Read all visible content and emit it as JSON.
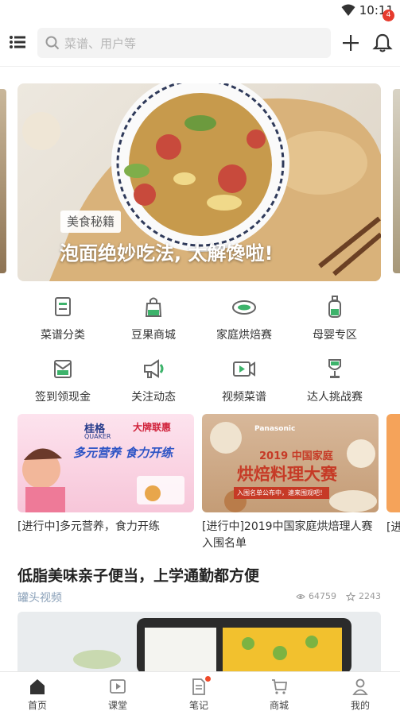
{
  "status_bar": {
    "time": "10:11"
  },
  "header": {
    "search_placeholder": "菜谱、用户等",
    "notification_count": "4"
  },
  "banner": {
    "tag": "美食秘籍",
    "title": "泡面绝妙吃法, 太解馋啦!"
  },
  "categories": [
    {
      "label": "菜谱分类",
      "icon": "recipe-book-icon"
    },
    {
      "label": "豆果商城",
      "icon": "shopping-bag-icon"
    },
    {
      "label": "家庭烘焙赛",
      "icon": "baking-dish-icon"
    },
    {
      "label": "母婴专区",
      "icon": "baby-bottle-icon"
    },
    {
      "label": "签到领现金",
      "icon": "checkin-icon"
    },
    {
      "label": "关注动态",
      "icon": "megaphone-icon"
    },
    {
      "label": "视频菜谱",
      "icon": "video-camera-icon"
    },
    {
      "label": "达人挑战赛",
      "icon": "trophy-icon"
    }
  ],
  "events": [
    {
      "text": "[进行中]多元营养，食力开练",
      "img_brand_a": "桂格",
      "img_brand_a_sub": "QUAKER",
      "img_brand_b": "大牌联惠",
      "img_headline": "多元营养 食力开练"
    },
    {
      "text": "[进行中]2019中国家庭烘焙理人赛入围名单",
      "img_brand": "Panasonic",
      "img_year": "2019 中国家庭",
      "img_headline": "烘焙料理大赛",
      "img_sub": "入围名单公布中，速来围观吧！"
    }
  ],
  "event_peek_text": "[进",
  "article": {
    "title": "低脂美味亲子便当，上学通勤都方便",
    "source": "罐头视频",
    "views": "64759",
    "likes": "2243"
  },
  "tabs": [
    {
      "label": "首页",
      "icon": "home-icon"
    },
    {
      "label": "课堂",
      "icon": "classroom-play-icon"
    },
    {
      "label": "笔记",
      "icon": "notes-icon"
    },
    {
      "label": "商城",
      "icon": "cart-icon"
    },
    {
      "label": "我的",
      "icon": "profile-icon"
    }
  ],
  "colors": {
    "accent_green": "#3db36b",
    "badge_red": "#e63b2e",
    "source_blue": "#8aa0b8"
  }
}
